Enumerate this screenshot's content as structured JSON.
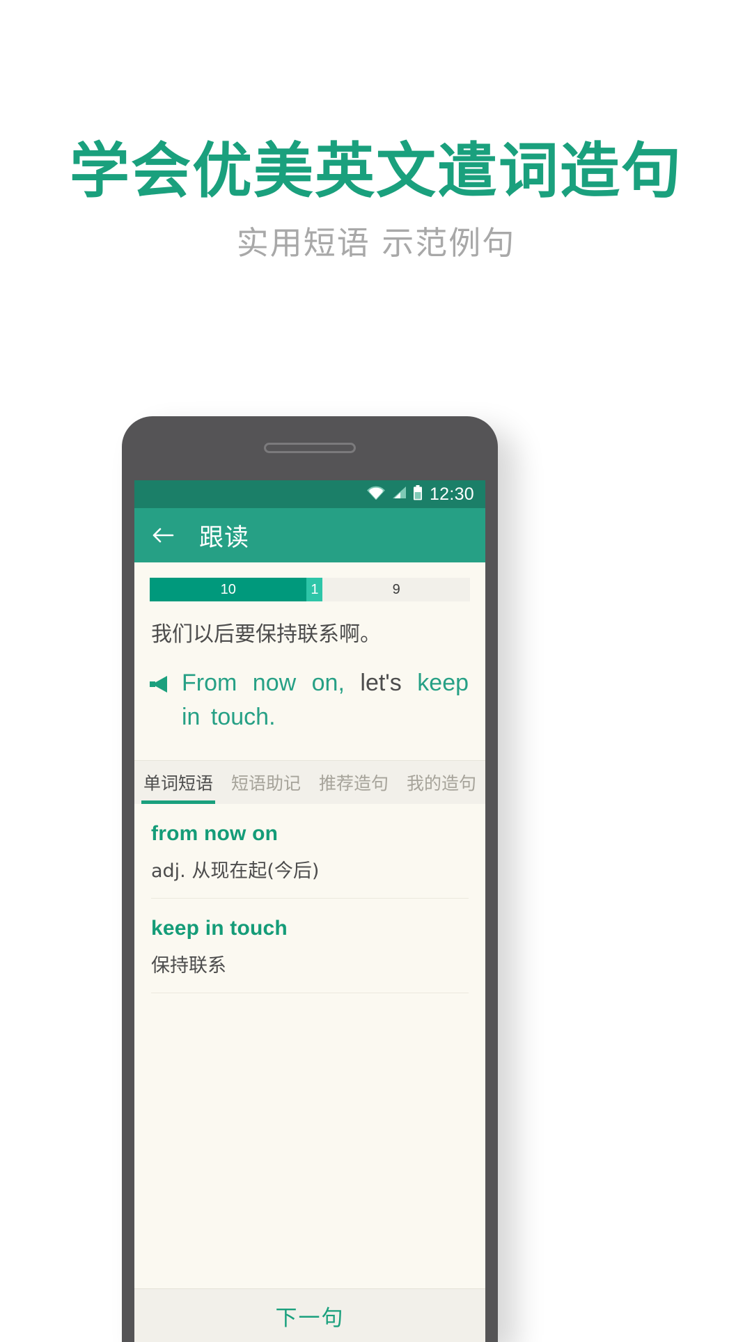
{
  "promo": {
    "title": "学会优美英文遣词造句",
    "subtitle": "实用短语 示范例句",
    "title_color": "#1aa07d",
    "subtitle_color": "#a8a8a8"
  },
  "phone": {
    "statusbar": {
      "time": "12:30",
      "icons": [
        "wifi-icon",
        "signal-icon",
        "battery-icon"
      ],
      "background": "#1b7f68"
    },
    "appbar": {
      "back_icon": "back-arrow-icon",
      "title": "跟读",
      "background": "#26a085"
    },
    "progress": {
      "segments": [
        {
          "label": "10",
          "state": "done",
          "color": "#00997c",
          "flex": 49
        },
        {
          "label": "1",
          "state": "current",
          "color": "#2ec5a8",
          "flex": 5
        },
        {
          "label": "9",
          "state": "remaining",
          "color": "#f2f0ea",
          "flex": 46
        }
      ]
    },
    "sentence": {
      "chinese": "我们以后要保持联系啊。",
      "speaker_icon": "speaker-icon",
      "english_parts": [
        {
          "text": "From now on,",
          "highlight": true
        },
        {
          "text": "let's",
          "highlight": false
        },
        {
          "text": "keep in touch.",
          "highlight": true
        }
      ]
    },
    "tabs": [
      {
        "label": "单词短语",
        "active": true
      },
      {
        "label": "短语助记",
        "active": false
      },
      {
        "label": "推荐造句",
        "active": false
      },
      {
        "label": "我的造句",
        "active": false
      }
    ],
    "phrases": [
      {
        "en": "from now on",
        "zh": "adj. 从现在起(今后)"
      },
      {
        "en": "keep in touch",
        "zh": "保持联系"
      }
    ],
    "bottom_button": "下一句"
  }
}
